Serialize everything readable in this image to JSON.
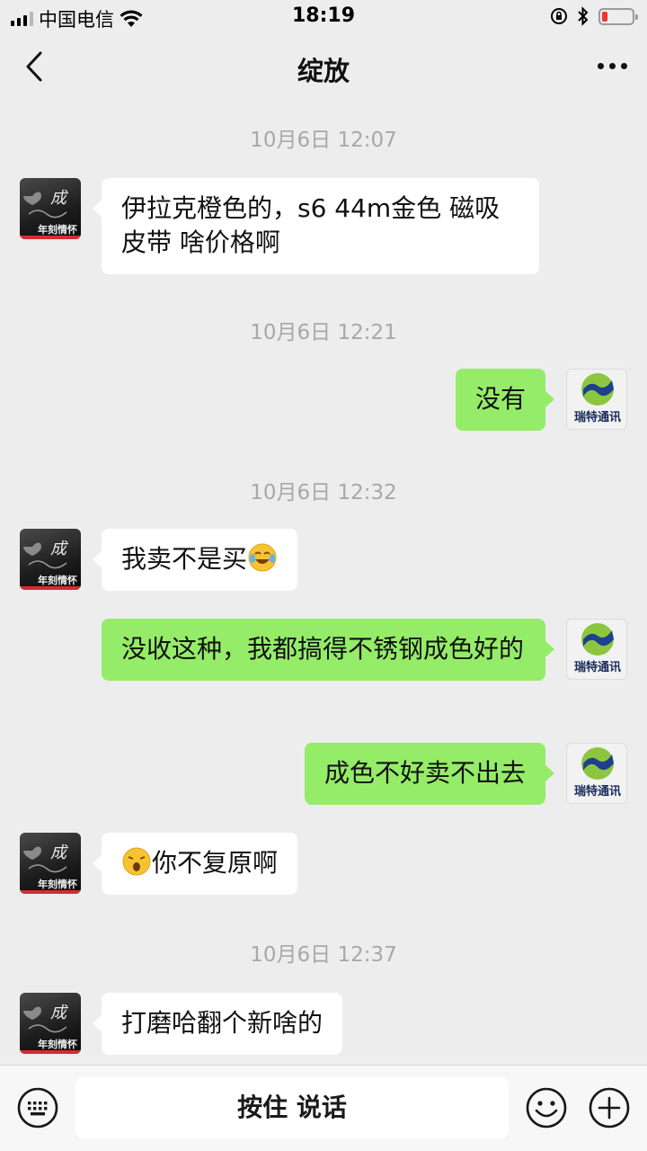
{
  "status_bar": {
    "carrier": "中国电信",
    "time": "18:19",
    "icons": [
      "signal-icon",
      "wifi-icon",
      "orientation-lock-icon",
      "bluetooth-icon",
      "battery-icon"
    ]
  },
  "nav": {
    "title": "绽放",
    "back_icon": "chevron-left-icon",
    "more_icon": "more-icon"
  },
  "messages": {
    "ts1": "10月6日 12:07",
    "m1": "伊拉克橙色的，s6 44m金色 磁吸皮带  啥价格啊",
    "ts2": "10月6日 12:21",
    "m2": "没有",
    "ts3": "10月6日 12:32",
    "m3": "我卖不是买",
    "m4": "没收这种，我都搞得不锈钢成色好的",
    "m5": "成色不好卖不出去",
    "m6": "你不复原啊",
    "ts4": "10月6日 12:37",
    "m7": "打磨哈翻个新啥的"
  },
  "avatars": {
    "left_text_top": "成",
    "left_text_bottom": "年刻情怀",
    "right_text": "瑞特通讯"
  },
  "colors": {
    "background": "#ededed",
    "sent_bubble": "#95ec69",
    "received_bubble": "#ffffff",
    "timestamp": "#a8a8a8"
  },
  "input_bar": {
    "hold_to_talk": "按住 说话",
    "keyboard_icon": "keyboard-icon",
    "emoji_icon": "emoji-icon",
    "plus_icon": "plus-icon"
  }
}
